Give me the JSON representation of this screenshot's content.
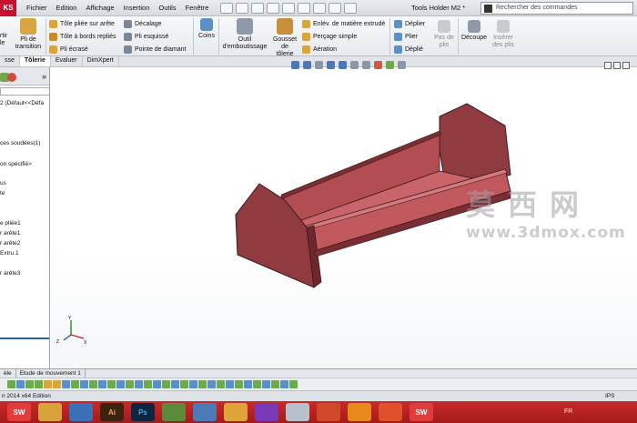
{
  "app": {
    "logo": "KS",
    "doc_title": "Tools Holder M2 *"
  },
  "menu": [
    "Fichier",
    "Edition",
    "Affichage",
    "Insertion",
    "Outils",
    "Fenêtre"
  ],
  "search": {
    "placeholder": "Rechercher des commandes"
  },
  "ribbon": {
    "convert": "rtir",
    "convert2": "le",
    "pli_transition": [
      "Pli de",
      "transition"
    ],
    "rows_a": [
      "Tôle pliée sur arête",
      "Tôle à bords repliés",
      "Pli écrasé"
    ],
    "rows_b": [
      "Décalage",
      "Pli esquissé",
      "Pointe de diamant"
    ],
    "coins": "Coins",
    "outil": [
      "Outil",
      "d'emboutissage"
    ],
    "gousset": [
      "Gousset",
      "de",
      "tôlerie"
    ],
    "rows_c": [
      "Enlév. de matière extrudé",
      "Perçage simple",
      "Aération"
    ],
    "rows_d": [
      "Déplier",
      "Plier",
      "Déplié"
    ],
    "pas_de_plis": [
      "Pas de",
      "plis"
    ],
    "decoupe": "Découpe",
    "inserer": [
      "Insérer",
      "des plis"
    ]
  },
  "tabs": [
    "sse",
    "Tôlerie",
    "Evaluer",
    "DimXpert"
  ],
  "tree": {
    "items": [
      "2  (Défaut<<Défa",
      "ces soudées(1)",
      "on spécifié>",
      "us",
      "te",
      "e pliée1",
      "r arête1",
      "r arête2",
      "Extru.1",
      "r arête3"
    ]
  },
  "bottom_tabs": [
    "èle",
    "Etude de mouvement 1"
  ],
  "status": {
    "left": "n 2014 x64 Edition",
    "right": "IPS"
  },
  "taskbar": {
    "lang": "FR"
  },
  "watermark": {
    "cn": "莫西网",
    "url": "www.3dmox.com"
  },
  "colors": {
    "part_face": "#c0585d",
    "part_dark": "#7a2e33",
    "part_side": "#8f3b40",
    "taskbar": "#b82222"
  }
}
